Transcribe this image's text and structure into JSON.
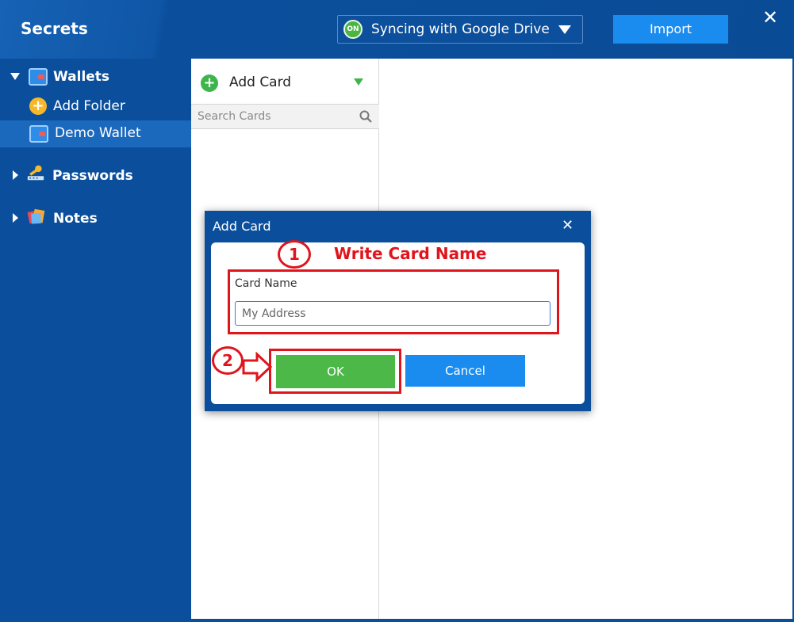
{
  "app": {
    "title": "Secrets"
  },
  "header": {
    "sync_badge": "ON",
    "sync_label": "Syncing with Google Drive",
    "import_label": "Import",
    "close_label": "✕"
  },
  "sidebar": {
    "wallets_label": "Wallets",
    "add_folder_label": "Add Folder",
    "demo_wallet_label": "Demo Wallet",
    "passwords_label": "Passwords",
    "notes_label": "Notes"
  },
  "cards_panel": {
    "add_card_label": "Add Card",
    "search_placeholder": "Search Cards"
  },
  "dialog": {
    "title": "Add Card",
    "close_label": "✕",
    "field_label": "Card Name",
    "field_placeholder": "My Address",
    "ok_label": "OK",
    "cancel_label": "Cancel"
  },
  "annotations": {
    "step1_number": "1",
    "step1_text": "Write Card Name",
    "step2_number": "2"
  },
  "colors": {
    "brand_blue": "#0b4f9c",
    "accent_blue": "#1a8cf0",
    "ok_green": "#4cb848",
    "annotation_red": "#e0141c"
  }
}
